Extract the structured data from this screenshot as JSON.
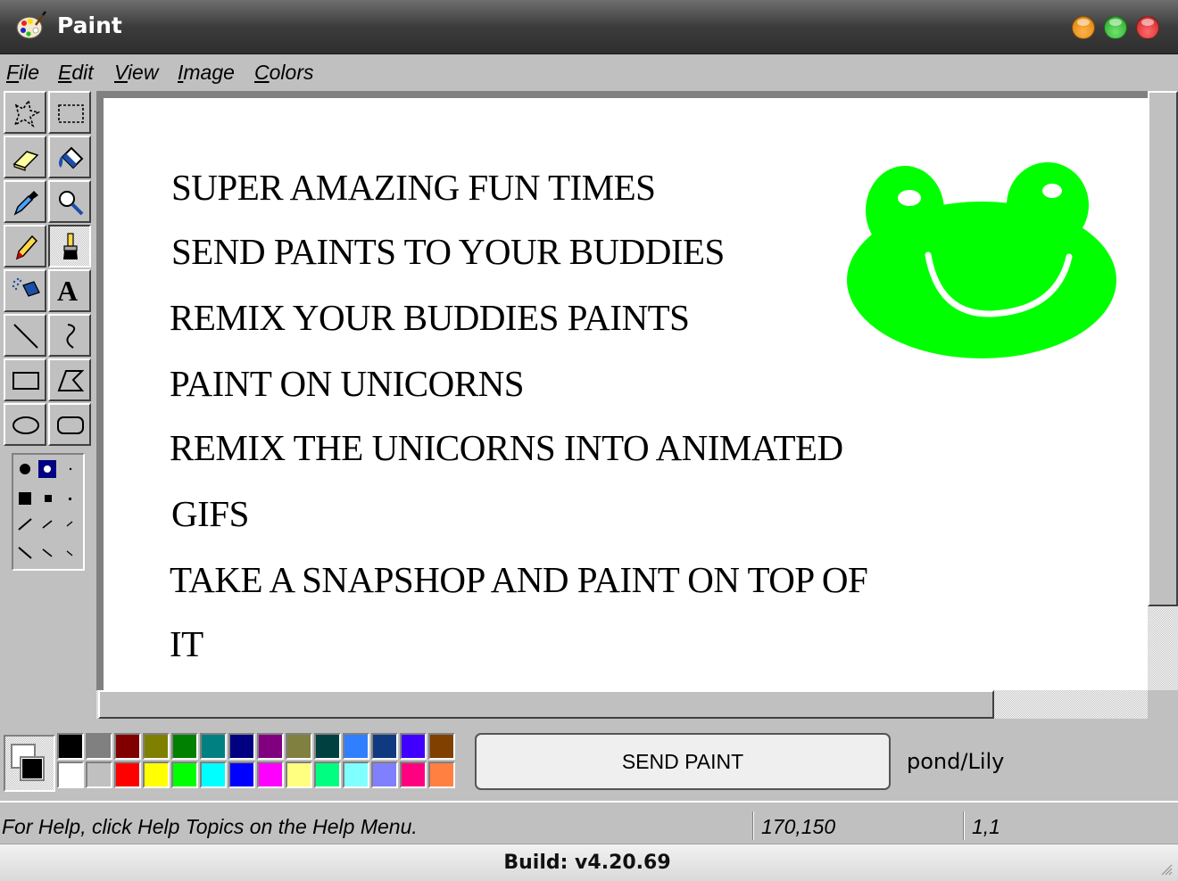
{
  "window": {
    "title": "Paint"
  },
  "menu": [
    {
      "pre": "",
      "key": "F",
      "post": "ile"
    },
    {
      "pre": "",
      "key": "E",
      "post": "dit"
    },
    {
      "pre": "",
      "key": "V",
      "post": "iew"
    },
    {
      "pre": "",
      "key": "I",
      "post": "mage"
    },
    {
      "pre": "",
      "key": "C",
      "post": "olors"
    }
  ],
  "tools": [
    "free-select",
    "rect-select",
    "eraser",
    "fill",
    "color-picker",
    "magnifier",
    "pencil",
    "brush",
    "airbrush",
    "text",
    "line",
    "curve",
    "rectangle",
    "polygon",
    "ellipse",
    "rounded-rectangle"
  ],
  "active_tool": "brush",
  "text_tool_glyph": "A",
  "canvas": {
    "lines": [
      "SUPER AMAZING FUN TIMES",
      "SEND PAINTS TO YOUR BUDDIES",
      "REMIX YOUR BUDDIES PAINTS",
      "PAINT ON UNICORNS",
      "REMIX THE UNICORNS INTO ANIMATED",
      "GIFS",
      "TAKE A SNAPSHOP AND PAINT ON TOP OF",
      "IT"
    ],
    "drawing": "green-frog-face",
    "frog_color": "#00ff00"
  },
  "palette": {
    "foreground": "#000000",
    "background": "#ffffff",
    "top_row": [
      "#000000",
      "#808080",
      "#800000",
      "#808000",
      "#008000",
      "#008080",
      "#000080",
      "#800080",
      "#808040",
      "#004040",
      "#2f7fff",
      "#0f3a80",
      "#4000ff",
      "#804000"
    ],
    "bottom_row": [
      "#ffffff",
      "#c0c0c0",
      "#ff0000",
      "#ffff00",
      "#00ff00",
      "#00ffff",
      "#0000ff",
      "#ff00ff",
      "#ffff80",
      "#00ff80",
      "#80ffff",
      "#8080ff",
      "#ff0080",
      "#ff8040"
    ]
  },
  "send_button": "SEND PAINT",
  "room": "pond/Lily",
  "status": {
    "help": "For Help, click Help Topics on the Help Menu.",
    "coords": "170,150",
    "size": "1,1"
  },
  "build": "Build: v4.20.69"
}
